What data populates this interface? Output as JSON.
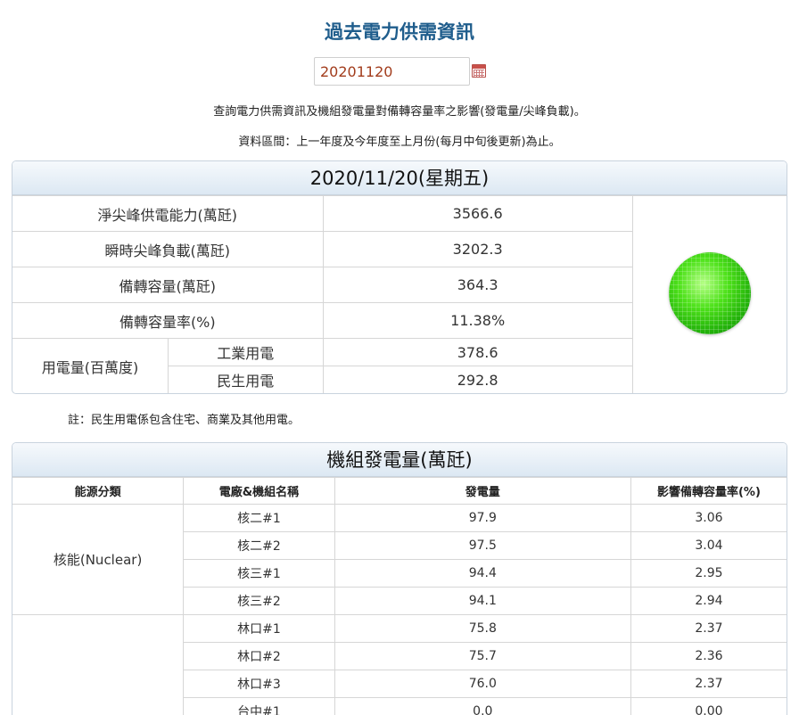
{
  "page": {
    "title": "過去電力供需資訊",
    "date_value": "20201120",
    "description_1": "查詢電力供需資訊及機組發電量對備轉容量率之影響(發電量/尖峰負載)。",
    "description_2": "資料區間：上一年度及今年度至上月份(每月中旬後更新)為止。",
    "note": "註：民生用電係包含住宅、商業及其他用電。"
  },
  "summary": {
    "header": "2020/11/20(星期五)",
    "rows": [
      {
        "label": "淨尖峰供電能力(萬瓩)",
        "value": "3566.6"
      },
      {
        "label": "瞬時尖峰負載(萬瓩)",
        "value": "3202.3"
      },
      {
        "label": "備轉容量(萬瓩)",
        "value": "364.3"
      },
      {
        "label": "備轉容量率(%)",
        "value": "11.38%"
      }
    ],
    "usage_label": "用電量(百萬度)",
    "usage": [
      {
        "label": "工業用電",
        "value": "378.6"
      },
      {
        "label": "民生用電",
        "value": "292.8"
      }
    ],
    "indicator_color": "#22b10a",
    "indicator_icon": "green-light-icon"
  },
  "generation": {
    "header": "機組發電量(萬瓩)",
    "columns": [
      "能源分類",
      "電廠&機組名稱",
      "發電量",
      "影響備轉容量率(%)"
    ],
    "nuclear_label": "核能(Nuclear)",
    "rows": [
      {
        "unit": "核二#1",
        "output": "97.9",
        "impact": "3.06"
      },
      {
        "unit": "核二#2",
        "output": "97.5",
        "impact": "3.04"
      },
      {
        "unit": "核三#1",
        "output": "94.4",
        "impact": "2.95"
      },
      {
        "unit": "核三#2",
        "output": "94.1",
        "impact": "2.94"
      },
      {
        "unit": "林口#1",
        "output": "75.8",
        "impact": "2.37"
      },
      {
        "unit": "林口#2",
        "output": "75.7",
        "impact": "2.36"
      },
      {
        "unit": "林口#3",
        "output": "76.0",
        "impact": "2.37"
      },
      {
        "unit": "台中#1",
        "output": "0.0",
        "impact": "0.00"
      }
    ]
  },
  "colors": {
    "title": "#1f5d8c",
    "date_text": "#a23c1c",
    "panel_header_bg": "#dce8f3",
    "border": "#d6d6d6"
  }
}
